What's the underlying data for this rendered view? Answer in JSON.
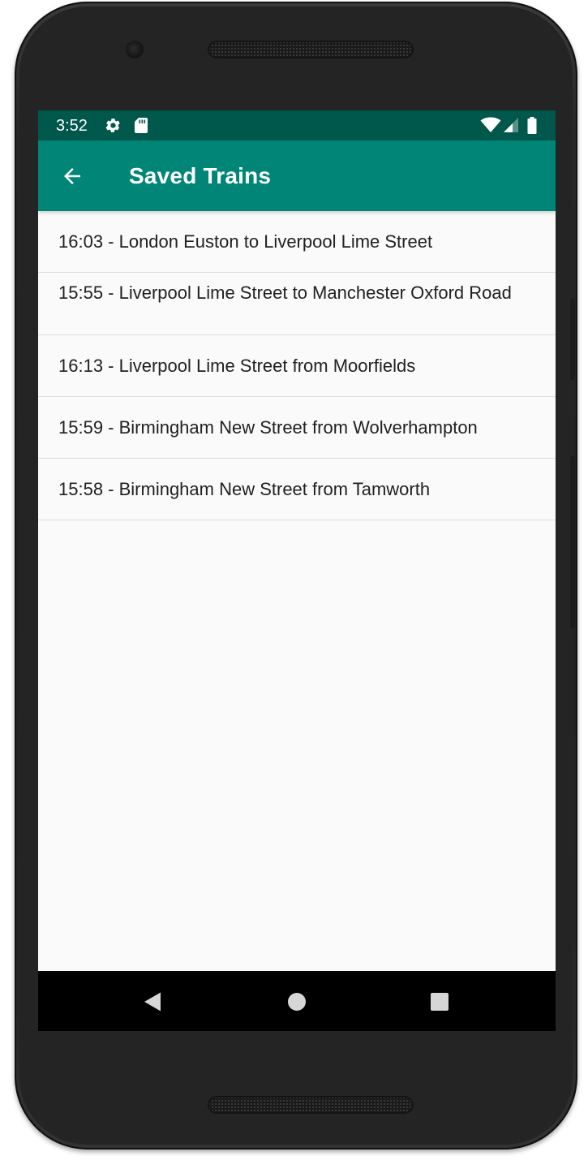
{
  "status_bar": {
    "time": "3:52",
    "icons": [
      "gear-icon",
      "sd-card-icon",
      "wifi-icon",
      "cell-signal-icon",
      "battery-icon"
    ],
    "background": "#00574b"
  },
  "app_bar": {
    "title": "Saved Trains",
    "back_icon": "arrow-back-icon",
    "background": "#008577"
  },
  "saved_trains": [
    {
      "label": "16:03 - London Euston to Liverpool Lime Street"
    },
    {
      "label": "15:55 - Liverpool Lime Street to Manchester Oxford Road"
    },
    {
      "label": "16:13 - Liverpool Lime Street from Moorfields"
    },
    {
      "label": "15:59 - Birmingham New Street from Wolverhampton"
    },
    {
      "label": "15:58 - Birmingham New Street from Tamworth"
    }
  ],
  "nav_bar": {
    "buttons": [
      "back-triangle-icon",
      "home-circle-icon",
      "recents-square-icon"
    ]
  }
}
